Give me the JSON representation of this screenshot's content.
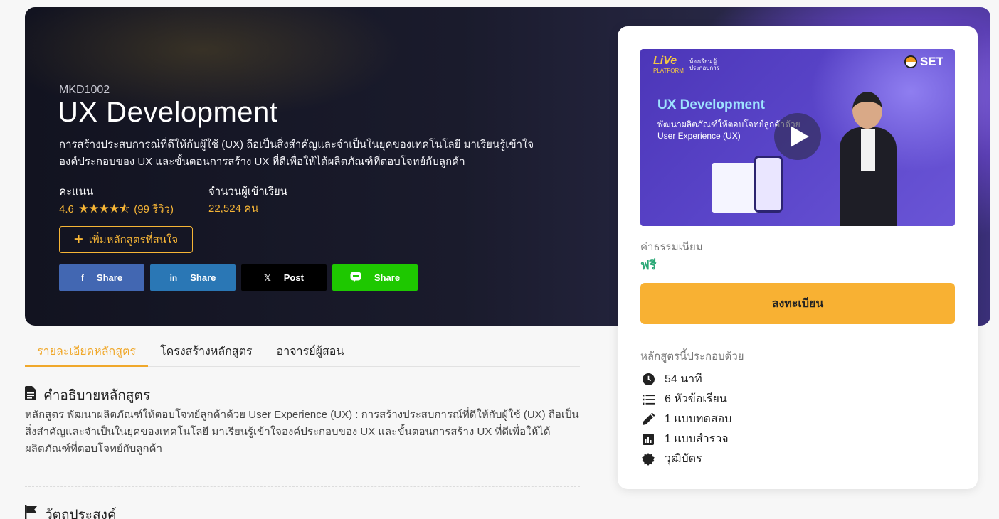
{
  "course": {
    "code": "MKD1002",
    "title": "UX Development",
    "description": "การสร้างประสบการณ์ที่ดีให้กับผู้ใช้ (UX) ถือเป็นสิ่งสำคัญและจำเป็นในยุคของเทคโนโลยี มาเรียนรู้เข้าใจองค์ประกอบของ UX และขั้นตอนการสร้าง UX ที่ดีเพื่อให้ได้ผลิตภัณฑ์ที่ตอบโจทย์กับลูกค้า",
    "rating_label": "คะแนน",
    "rating_value": "4.6",
    "rating": 4.6,
    "reviews": "(99 รีวิว)",
    "enrolled_label": "จำนวนผู้เข้าเรียน",
    "enrolled_value": "22,524 คน",
    "wishlist_label": "เพิ่มหลักสูตรที่สนใจ"
  },
  "share": {
    "facebook": {
      "label": "Share",
      "icon": "f",
      "color": "#4267b2"
    },
    "linkedin": {
      "label": "Share",
      "icon": "in",
      "color": "#2a77b5"
    },
    "x": {
      "label": "Post",
      "icon": "𝕏",
      "color": "#000000"
    },
    "line": {
      "label": "Share",
      "icon": "line-icon",
      "color": "#1ec800"
    }
  },
  "tabs": [
    {
      "label": "รายละเอียดหลักสูตร",
      "active": true
    },
    {
      "label": "โครงสร้างหลักสูตร",
      "active": false
    },
    {
      "label": "อาจารย์ผู้สอน",
      "active": false
    }
  ],
  "description_section": {
    "title": "คำอธิบายหลักสูตร",
    "body": "หลักสูตร พัฒนาผลิตภัณฑ์ให้ตอบโจทย์ลูกค้าด้วย User Experience (UX) : การสร้างประสบการณ์ที่ดีให้กับผู้ใช้ (UX) ถือเป็นสิ่งสำคัญและจำเป็นในยุคของเทคโนโลยี มาเรียนรู้เข้าใจองค์ประกอบของ UX และขั้นตอนการสร้าง UX ที่ดีเพื่อให้ได้ผลิตภัณฑ์ที่ตอบโจทย์กับลูกค้า"
  },
  "objective_section": {
    "title": "วัตถุประสงค์"
  },
  "card": {
    "video": {
      "brand_live": "LiVe",
      "brand_live_sub": "PLATFORM",
      "brand_room": "ห้องเรียน ผู้ประกอบการ",
      "brand_set": "SET",
      "title": "UX Development",
      "subtitle_line1": "พัฒนาผลิตภัณฑ์ให้ตอบโจทย์ลูกค้าด้วย",
      "subtitle_line2": "User Experience (UX)"
    },
    "fee_label": "ค่าธรรมเนียม",
    "fee_value": "ฟรี",
    "register_label": "ลงทะเบียน",
    "includes_label": "หลักสูตรนี้ประกอบด้วย",
    "includes": [
      {
        "icon": "clock-icon",
        "text": "54 นาที"
      },
      {
        "icon": "list-icon",
        "text": "6 หัวข้อเรียน"
      },
      {
        "icon": "pencil-icon",
        "text": "1 แบบทดสอบ"
      },
      {
        "icon": "chart-icon",
        "text": "1 แบบสำรวจ"
      },
      {
        "icon": "badge-icon",
        "text": "วุฒิบัตร"
      }
    ]
  }
}
